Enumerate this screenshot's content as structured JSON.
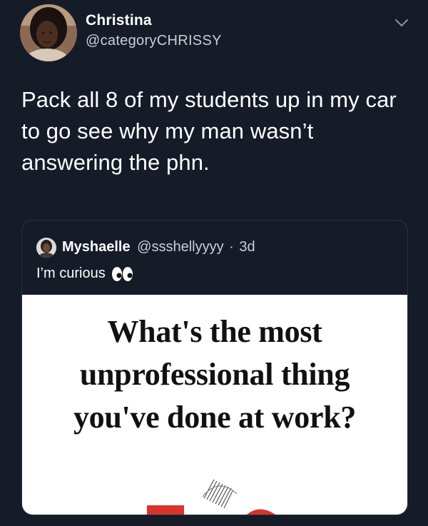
{
  "tweet": {
    "author": {
      "name": "Christina",
      "handle": "@categoryCHRISSY"
    },
    "text": "Pack all 8 of my students up in my car\nto go see why my man wasn’t\nanswering the phn."
  },
  "quoted_tweet": {
    "name": "Myshaelle",
    "handle": "@ssshellyyyy",
    "separator": "·",
    "time": "3d",
    "text": "I’m curious",
    "media": {
      "headline": "What's the most\nunprofessional thing\nyou've done at work?"
    }
  },
  "icons": {
    "menu": "chevron-down-icon",
    "eyes": "eyes-emoji-icon"
  },
  "colors": {
    "background": "#161b28",
    "text_primary": "#ffffff",
    "text_secondary": "#c9ced6",
    "card_border": "#2b3242"
  }
}
